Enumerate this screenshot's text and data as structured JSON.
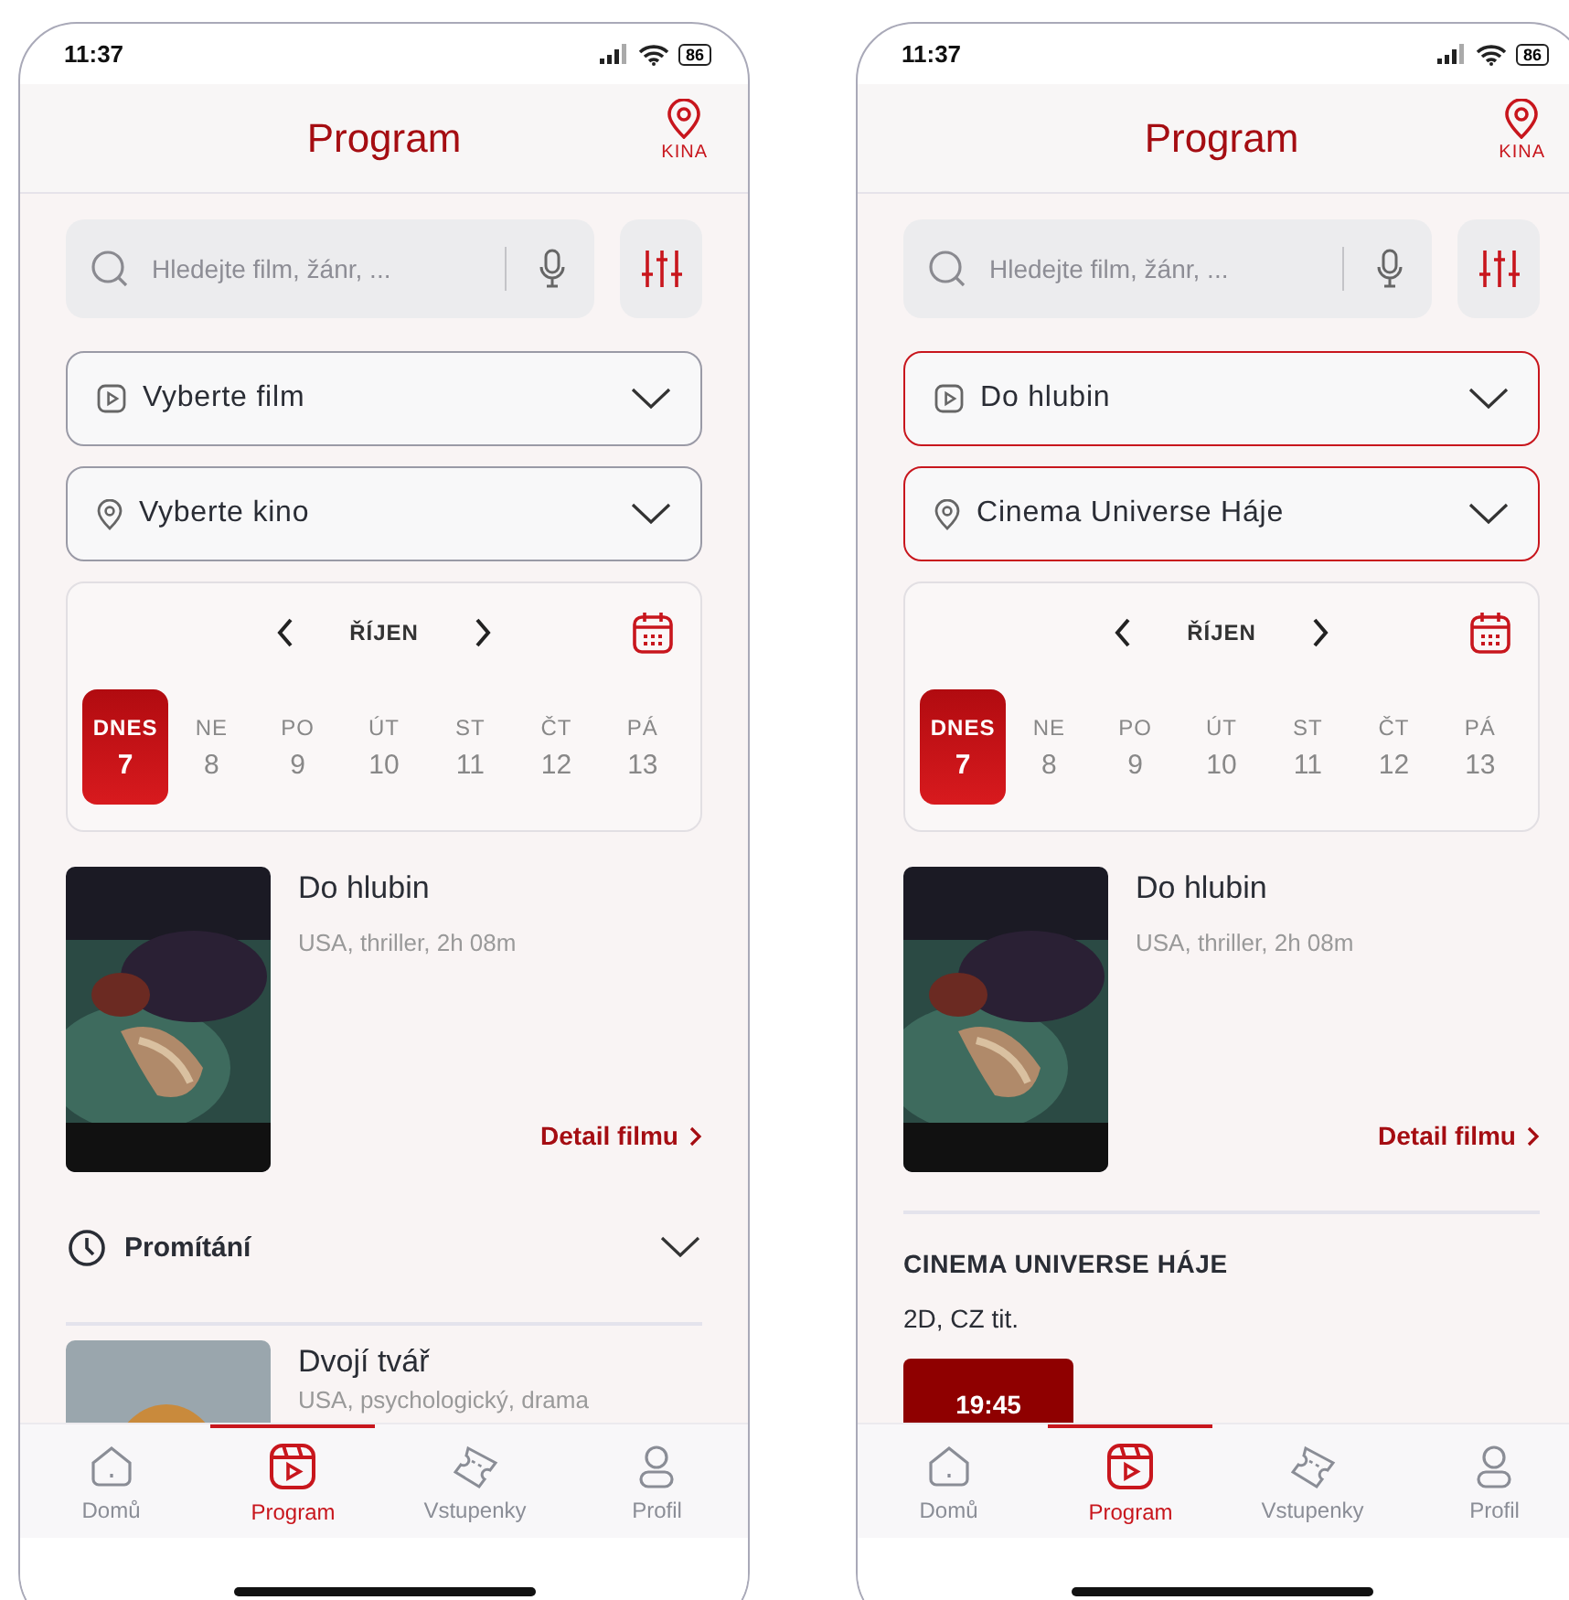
{
  "phones": [
    {
      "status_bar": {
        "time": "11:37",
        "battery": "86"
      },
      "header": {
        "title": "Program",
        "action_label": "KINA"
      },
      "search": {
        "placeholder": "Hledejte film, žánr, ..."
      },
      "selects": [
        {
          "kind": "film",
          "placeholder": "Vyberte film"
        },
        {
          "kind": "cinema",
          "placeholder": "Vyberte kino"
        }
      ],
      "calendar": {
        "month": "ŘÍJEN",
        "days": [
          {
            "weekday": "DNES",
            "day": "7",
            "selected": true
          },
          {
            "weekday": "NE",
            "day": "8",
            "selected": false
          },
          {
            "weekday": "PO",
            "day": "9",
            "selected": false
          },
          {
            "weekday": "ÚT",
            "day": "10",
            "selected": false
          },
          {
            "weekday": "ST",
            "day": "11",
            "selected": false
          },
          {
            "weekday": "ČT",
            "day": "12",
            "selected": false
          },
          {
            "weekday": "PÁ",
            "day": "13",
            "selected": false
          }
        ]
      },
      "film": {
        "title": "Do hlubin",
        "meta": "USA, thriller, 2h 08m",
        "detail_link": "Detail filmu"
      },
      "showings": {
        "kind": "collapsed",
        "label": "Promítání"
      },
      "more_films": [
        {
          "title": "Dvojí tvář",
          "meta": "USA, psychologický, drama"
        }
      ],
      "nav": [
        {
          "label": "Domů",
          "selected": false
        },
        {
          "label": "Program",
          "selected": true
        },
        {
          "label": "Vstupenky",
          "selected": false
        },
        {
          "label": "Profil",
          "selected": false
        }
      ]
    },
    {
      "status_bar": {
        "time": "11:37",
        "battery": "86"
      },
      "header": {
        "title": "Program",
        "action_label": "KINA"
      },
      "search": {
        "placeholder": "Hledejte film, žánr, ..."
      },
      "selects": [
        {
          "kind": "film",
          "value": "Do hlubin"
        },
        {
          "kind": "cinema",
          "value": "Cinema Universe Háje"
        }
      ],
      "calendar": {
        "month": "ŘÍJEN",
        "days": [
          {
            "weekday": "DNES",
            "day": "7",
            "selected": true
          },
          {
            "weekday": "NE",
            "day": "8",
            "selected": false
          },
          {
            "weekday": "PO",
            "day": "9",
            "selected": false
          },
          {
            "weekday": "ÚT",
            "day": "10",
            "selected": false
          },
          {
            "weekday": "ST",
            "day": "11",
            "selected": false
          },
          {
            "weekday": "ČT",
            "day": "12",
            "selected": false
          },
          {
            "weekday": "PÁ",
            "day": "13",
            "selected": false
          }
        ]
      },
      "film": {
        "title": "Do hlubin",
        "meta": "USA, thriller, 2h 08m",
        "detail_link": "Detail filmu"
      },
      "showings": {
        "kind": "expanded",
        "cinema": "CINEMA UNIVERSE HÁJE",
        "format": "2D, CZ tit.",
        "times": [
          "19:45"
        ]
      },
      "nav": [
        {
          "label": "Domů",
          "selected": false
        },
        {
          "label": "Program",
          "selected": true
        },
        {
          "label": "Vstupenky",
          "selected": false
        },
        {
          "label": "Profil",
          "selected": false
        }
      ]
    }
  ]
}
